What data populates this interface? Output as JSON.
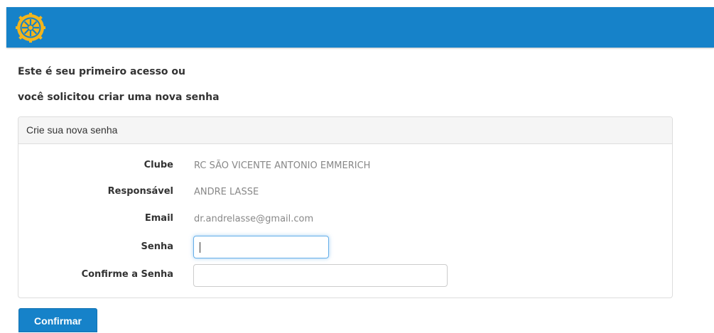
{
  "header": {
    "logo_icon": "rotary-wheel-icon",
    "bar_color": "#1682c9",
    "logo_color": "#f2b51d"
  },
  "intro": {
    "line1": "Este é seu primeiro acesso ou",
    "line2": "você solicitou criar uma nova senha"
  },
  "panel": {
    "title": "Crie sua nova senha",
    "fields": {
      "clube_label": "Clube",
      "clube_value": "RC SÃO VICENTE ANTONIO EMMERICH",
      "responsavel_label": "Responsável",
      "responsavel_value": "ANDRE LASSE",
      "email_label": "Email",
      "email_value": "dr.andrelasse@gmail.com",
      "senha_label": "Senha",
      "senha_value": "",
      "confirme_label": "Confirme a Senha",
      "confirme_value": ""
    }
  },
  "actions": {
    "confirm_label": "Confirmar"
  }
}
